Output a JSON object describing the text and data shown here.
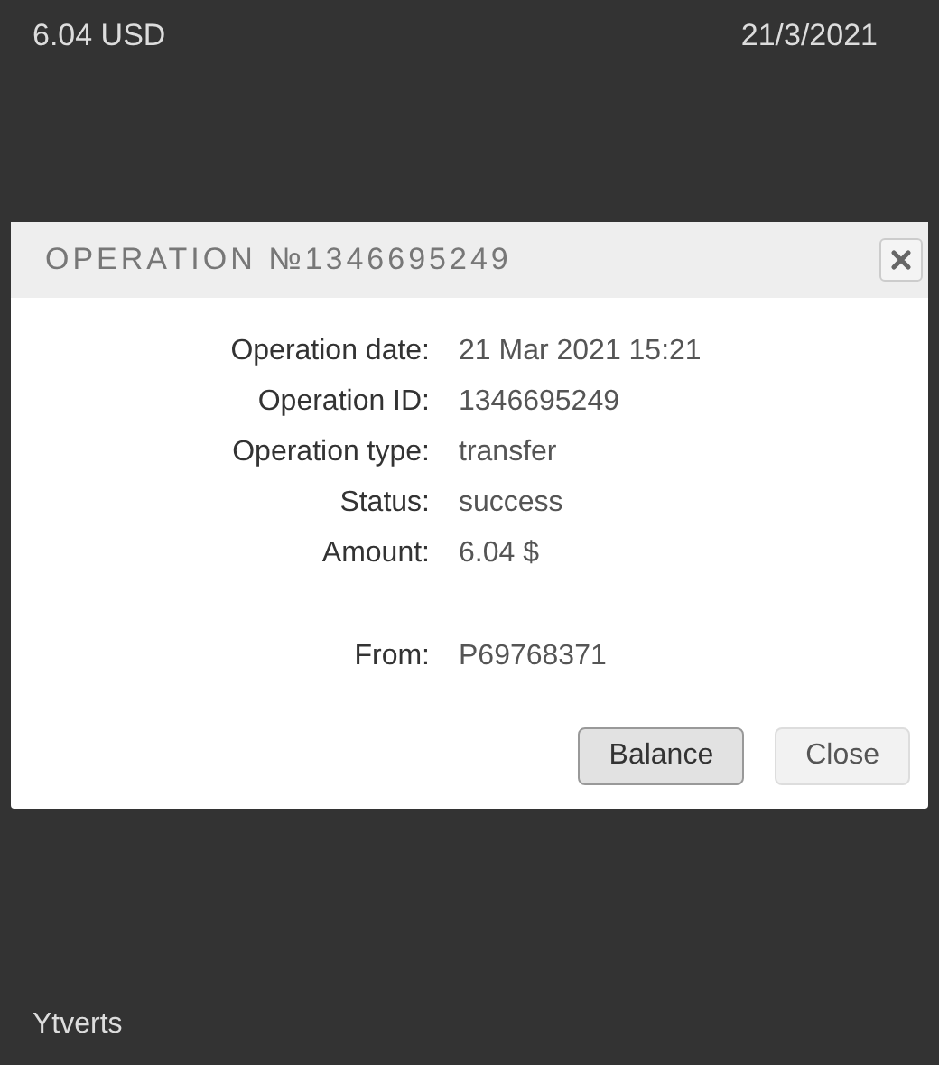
{
  "top_bar": {
    "balance": "6.04 USD",
    "date": "21/3/2021"
  },
  "dialog": {
    "title": "OPERATION №1346695249",
    "details": [
      {
        "label": "Operation date:",
        "value": "21 Mar 2021 15:21"
      },
      {
        "label": "Operation ID:",
        "value": "1346695249"
      },
      {
        "label": "Operation type:",
        "value": "transfer"
      },
      {
        "label": "Status:",
        "value": "success"
      },
      {
        "label": "Amount:",
        "value": "6.04 $"
      }
    ],
    "source": [
      {
        "label": "From:",
        "value": "P69768371"
      }
    ],
    "buttons": [
      {
        "label": "Balance",
        "selected": true
      },
      {
        "label": "Close",
        "selected": false
      }
    ]
  },
  "footer": {
    "text": "Ytverts"
  }
}
